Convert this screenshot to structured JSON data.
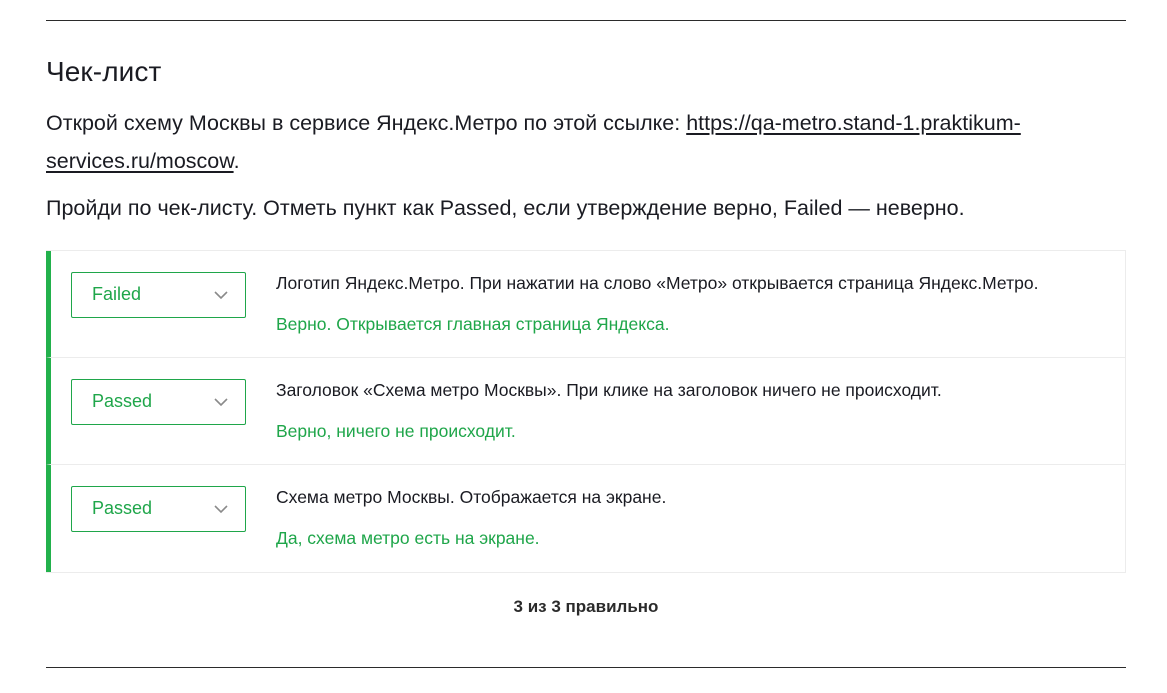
{
  "title": "Чек-лист",
  "intro": {
    "text_before": "Открой схему Москвы в сервисе Яндекс.Метро по этой ссылке: ",
    "link_text": "https://qa-metro.stand-1.praktikum-services.ru/moscow",
    "text_after": "."
  },
  "instructions": "Пройди по чек-листу. Отметь пункт как Passed, если утверждение верно, Failed — неверно.",
  "colors": {
    "accent_green": "#1fa64a",
    "left_bar": "#22b14c",
    "text": "#1a1b22"
  },
  "icons": {
    "dropdown": "chevron-down-icon"
  },
  "checklist": [
    {
      "selected": "Failed",
      "statement": "Логотип Яндекс.Метро. При нажатии на слово «Метро» открывается страница Яндекс.Метро.",
      "feedback": "Верно. Открывается главная страница Яндекса."
    },
    {
      "selected": "Passed",
      "statement": "Заголовок «Схема метро Москвы». При клике на заголовок ничего не происходит.",
      "feedback": "Верно, ничего не происходит."
    },
    {
      "selected": "Passed",
      "statement": "Схема метро Москвы. Отображается на экране.",
      "feedback": "Да, схема метро есть на экране."
    }
  ],
  "summary": "3 из 3 правильно"
}
